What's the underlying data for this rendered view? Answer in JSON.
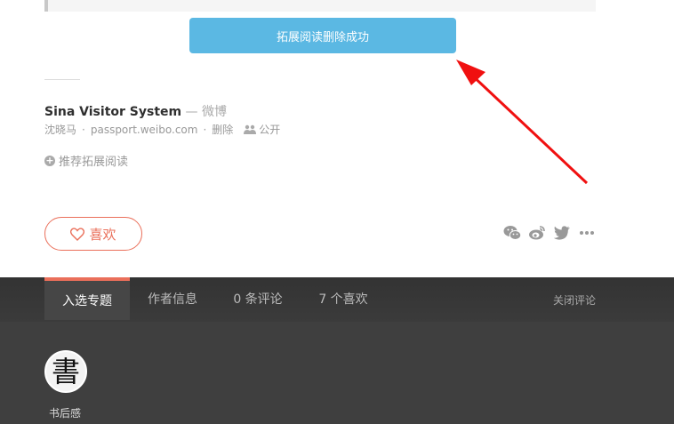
{
  "toast": {
    "message": "拓展阅读删除成功"
  },
  "extended_reading": {
    "title": "Sina Visitor System",
    "source": " — 微博",
    "author": "沈晓马",
    "domain": "passport.weibo.com",
    "delete_label": "删除",
    "visibility": "公开",
    "recommend_label": "推荐拓展阅读"
  },
  "like_button": {
    "label": "喜欢"
  },
  "share_icons": [
    "wechat-icon",
    "weibo-icon",
    "twitter-icon",
    "more-icon"
  ],
  "tabs": [
    {
      "label": "入选专题",
      "active": true
    },
    {
      "label": "作者信息",
      "active": false
    },
    {
      "label": "0 条评论",
      "active": false
    },
    {
      "label": "7 个喜欢",
      "active": false
    }
  ],
  "close_comments_label": "关闭评论",
  "collection": {
    "name": "书后感",
    "avatar_glyph": "書"
  },
  "colors": {
    "accent": "#ea6f5a",
    "toast": "#5bb8e3",
    "dark_bg": "#3f3f3f",
    "arrow": "#f01010"
  }
}
